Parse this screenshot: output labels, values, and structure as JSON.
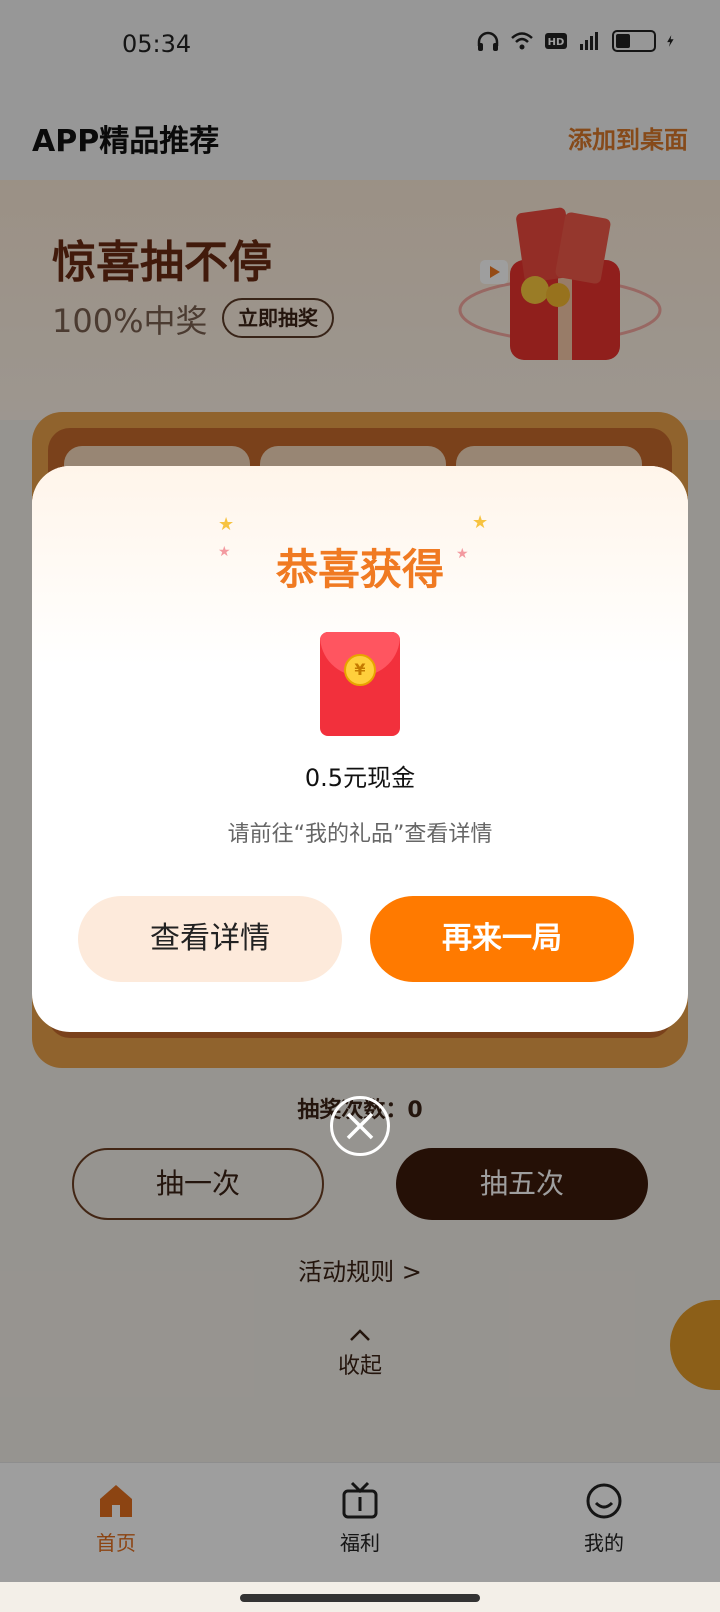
{
  "status_bar": {
    "time": "05:34",
    "icons": [
      "headphones-icon",
      "wifi-icon",
      "hd-icon",
      "4g-signal-icon",
      "battery-icon",
      "charging-icon"
    ]
  },
  "header": {
    "title": "APP精品推荐",
    "add_to_desktop": "添加到桌面"
  },
  "banner": {
    "title": "惊喜抽不停",
    "subtitle": "100%中奖",
    "button": "立即抽奖"
  },
  "lottery": {
    "draw_count_label": "抽奖次数：",
    "draw_count": "0",
    "draw_once": "抽一次",
    "draw_five": "抽五次",
    "rules": "活动规则 >",
    "collapse": "收起"
  },
  "nav": {
    "items": [
      {
        "label": "首页",
        "icon": "home-icon"
      },
      {
        "label": "福利",
        "icon": "tv-icon"
      },
      {
        "label": "我的",
        "icon": "smile-icon"
      }
    ]
  },
  "dialog": {
    "title": "恭喜获得",
    "prize": "0.5元现金",
    "hint": "请前往“我的礼品”查看详情",
    "details_button": "查看详情",
    "again_button": "再来一局",
    "coin_symbol": "¥"
  },
  "colors": {
    "accent": "#ff7a00",
    "brown": "#3d1a0b",
    "frame": "#e8a14a",
    "title_orange": "#f07a22"
  }
}
